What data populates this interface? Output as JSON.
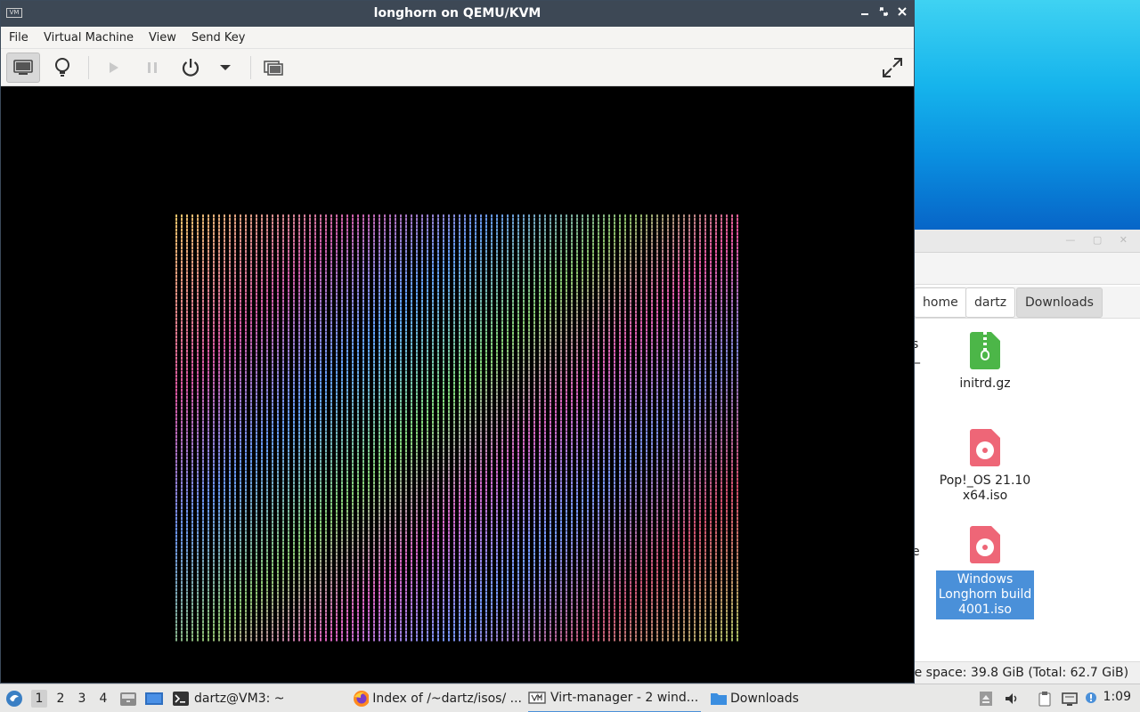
{
  "vm_window": {
    "title": "longhorn on QEMU/KVM",
    "app_icon_text": "VM",
    "menu": [
      "File",
      "Virtual Machine",
      "View",
      "Send Key"
    ],
    "toolbar": {
      "console_icon": "monitor-icon",
      "details_icon": "lightbulb-icon",
      "run_icon": "play-icon",
      "pause_icon": "pause-icon",
      "shutdown_icon": "power-icon",
      "shutdown_menu_icon": "chevron-down-icon",
      "snapshots_icon": "snapshots-icon",
      "fullscreen_icon": "fullscreen-icon"
    }
  },
  "file_manager": {
    "breadcrumbs": [
      "home",
      "dartz",
      "Downloads"
    ],
    "files": [
      {
        "name": "initrd.gz",
        "icon": "archive-icon"
      },
      {
        "name": "Pop!_OS 21.10 x64.iso",
        "icon": "disc-image-icon"
      },
      {
        "name": "Windows Longhorn build 4001.iso",
        "icon": "disc-image-icon",
        "selected": true
      }
    ],
    "cut_texts": [
      "s",
      "_",
      ".",
      "e"
    ],
    "status": "ee space: 39.8 GiB (Total: 62.7 GiB)"
  },
  "taskbar": {
    "workspaces": [
      "1",
      "2",
      "3",
      "4"
    ],
    "tasks": [
      {
        "label": "dartz@VM3: ~",
        "icon": "terminal-icon"
      },
      {
        "label": "Index of /~dartz/isos/ ...",
        "icon": "firefox-icon"
      },
      {
        "label": "Virt-manager - 2 wind...",
        "icon": "virt-manager-icon",
        "active": true
      },
      {
        "label": "Downloads",
        "icon": "folder-icon"
      }
    ],
    "clock": "1:09",
    "accent": "#4a90d9"
  }
}
